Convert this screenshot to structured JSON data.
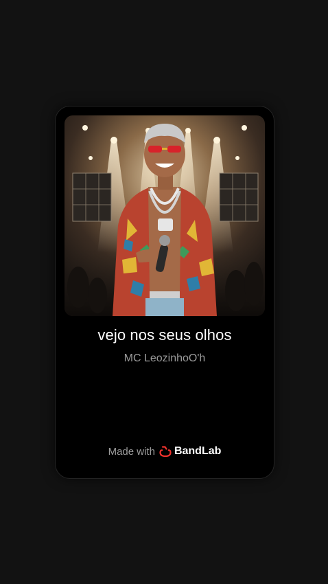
{
  "track": {
    "title": "vejo nos seus olhos",
    "artist": "MC LeozinhoO'h"
  },
  "footer": {
    "made_with": "Made with",
    "brand": "BandLab",
    "brand_icon": "bandlab-logo-icon"
  },
  "colors": {
    "page_background": "#121212",
    "card_background": "#000000",
    "brand_accent": "#f0322d",
    "artist_text": "#9a9a9a"
  }
}
